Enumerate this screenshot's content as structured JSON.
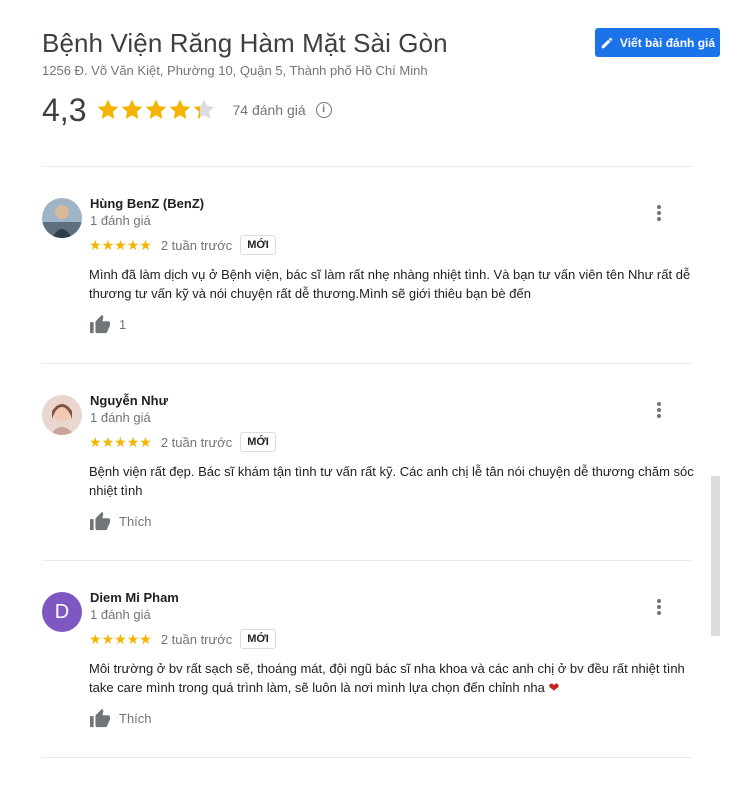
{
  "place": {
    "name": "Bệnh Viện Răng Hàm Mặt Sài Gòn",
    "address": "1256 Đ. Võ Văn Kiệt, Phường 10, Quận 5, Thành phố Hồ Chí Minh",
    "rating": "4,3",
    "rating_value": 4.3,
    "review_count": "74 đánh giá",
    "info_icon": "info-icon"
  },
  "write_button": {
    "label": "Viết bài đánh giá",
    "icon": "pencil-icon"
  },
  "colors": {
    "accent": "#1a73e8",
    "star": "#f4b400",
    "heart": "#c5221f"
  },
  "reviews": [
    {
      "author": "Hùng BenZ (BenZ)",
      "count": "1 đánh giá",
      "stars": 5,
      "time": "2 tuần trước",
      "badge": "MỚI",
      "text": "Mình đã làm dịch vụ ở Bệnh viện, bác sĩ làm rất nhẹ nhàng nhiệt tình. Và bạn tư vấn viên tên Như rất dễ thương tư vấn kỹ và nói chuyện rất dễ thương.Mình sẽ giới thiêu bạn bè đến",
      "like_label": "1",
      "avatar": "photo"
    },
    {
      "author": "Nguyễn Như",
      "count": "1 đánh giá",
      "stars": 5,
      "time": "2 tuần trước",
      "badge": "MỚI",
      "text": "Bệnh viện rất đẹp. Bác sĩ khám tận tình tư vấn rất kỹ. Các anh chị lễ tân nói chuyện dễ thương chăm sóc nhiệt tình",
      "like_label": "Thích",
      "avatar": "photo"
    },
    {
      "author": "Diem Mi Pham",
      "count": "1 đánh giá",
      "stars": 5,
      "time": "2 tuần trước",
      "badge": "MỚI",
      "text": "Môi trường ở bv rất sạch sẽ, thoáng mát, đội ngũ bác sĩ nha khoa và các anh chị ở bv đều rất nhiệt tình take care mình trong quá trình làm, sẽ luôn là nơi mình lựa chọn đến chỉnh nha",
      "text_suffix": "❤",
      "like_label": "Thích",
      "avatar_letter": "D"
    }
  ]
}
